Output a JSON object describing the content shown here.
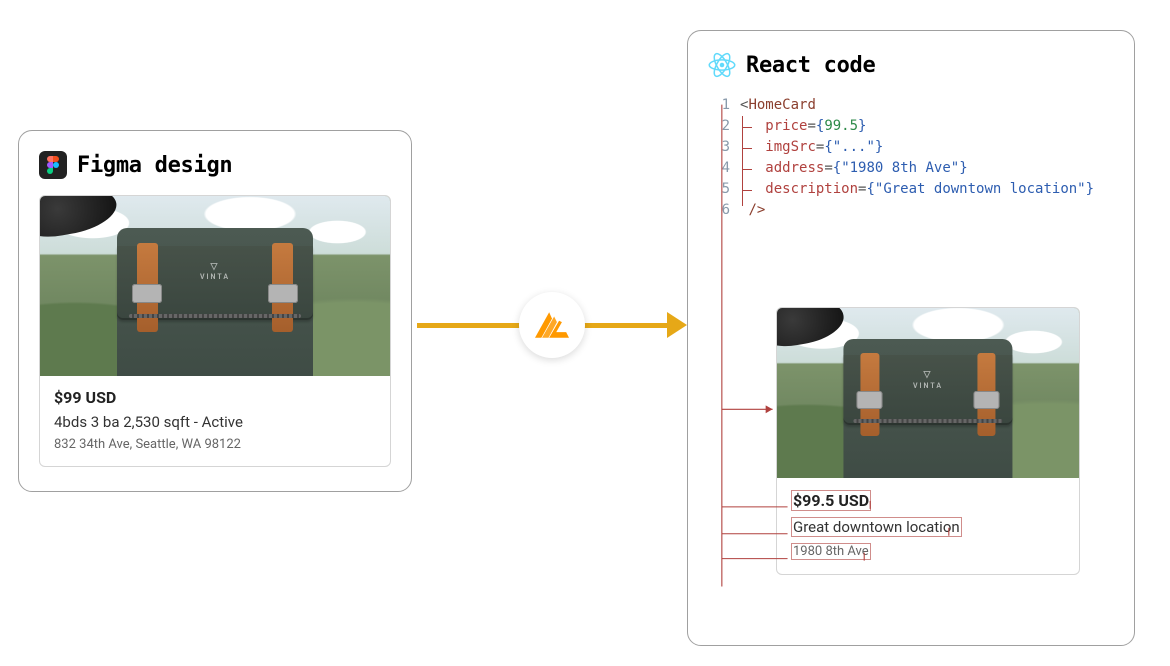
{
  "left": {
    "title": "Figma design",
    "card": {
      "brand": "VINTA",
      "price": "$99 USD",
      "desc": "4bds 3 ba 2,530 sqft - Active",
      "addr": "832 34th Ave, Seattle, WA 98122"
    }
  },
  "right": {
    "title": "React code",
    "code": {
      "tag": "HomeCard",
      "lines": [
        "1",
        "2",
        "3",
        "4",
        "5",
        "6"
      ],
      "props": {
        "price_key": "price",
        "price_val": "99.5",
        "img_key": "imgSrc",
        "img_val": "\"...\"",
        "addr_key": "address",
        "addr_val": "\"1980 8th Ave\"",
        "desc_key": "description",
        "desc_val": "\"Great downtown location\""
      }
    },
    "rendered": {
      "brand": "VINTA",
      "price": "$99.5 USD",
      "desc": "Great downtown location",
      "addr": "1980 8th Ave"
    }
  }
}
